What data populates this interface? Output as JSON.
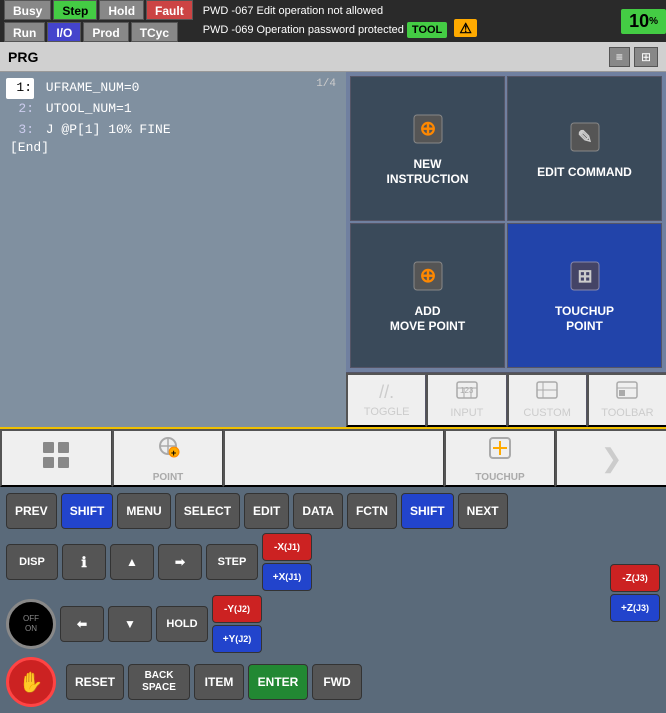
{
  "statusBar": {
    "buttons": [
      "Busy",
      "Step",
      "Hold",
      "Fault",
      "Run",
      "I/O",
      "Prod",
      "TCyc"
    ],
    "messages": [
      "PWD -067 Edit operation not allowed",
      "PWD -069 Operation password protected"
    ],
    "toolLabel": "TOOL",
    "percentValue": "10",
    "percentSuffix": "%"
  },
  "prg": {
    "title": "PRG",
    "lineCounter": "1/4",
    "lines": [
      {
        "num": "1:",
        "content": "UFRAME_NUM=0",
        "highlight": false
      },
      {
        "num": "2:",
        "content": "UTOOL_NUM=1",
        "highlight": false
      },
      {
        "num": "3:",
        "content": "J @P[1] 10% FINE",
        "highlight": false
      }
    ],
    "endLabel": "[End]",
    "highlightLine": "1:"
  },
  "rightPanel": {
    "newInstruction": {
      "label": "NEW\nINSTRUCTION",
      "icon": "⊕"
    },
    "editCommand": {
      "label": "EDIT COMMAND",
      "icon": "✎"
    },
    "addMovePoint": {
      "label": "ADD\nMOVE POINT",
      "icon": "⊕"
    },
    "touchupPoint": {
      "label": "TOUCHUP\nPOINT",
      "icon": "⊞"
    }
  },
  "toolbar": {
    "toggle": "TOGGLE",
    "input": "INPUT",
    "custom": "CUSTOM",
    "toolbarLabel": "TOOLBAR"
  },
  "bottomNav": {
    "point": "POINT",
    "touchup": "TOUCHUP",
    "next": "❯"
  },
  "keyboard": {
    "row1": [
      "PREV",
      "SHIFT",
      "MENU",
      "SELECT",
      "EDIT",
      "DATA",
      "FCTN",
      "SHIFT",
      "NEXT"
    ],
    "dispLabel": "DISP",
    "resetLabel": "RESET",
    "backspaceLabel": "BACK\nSPACE",
    "itemLabel": "ITEM",
    "enterLabel": "ENTER",
    "fwdLabel": "FWD",
    "holdLabel": "HOLD",
    "stepLabel": "STEP",
    "axisLabels": {
      "negX": "-X\n(J1)",
      "posX": "+X\n(J1)",
      "negY": "-Y\n(J2)",
      "posY": "+Y\n(J2)",
      "negZ": "-Z\n(J3)",
      "posZ": "+Z\n(J3)"
    }
  }
}
